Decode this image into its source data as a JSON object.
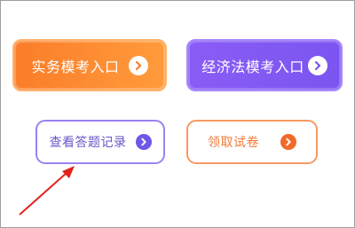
{
  "buttons": {
    "practice_exam": {
      "label": "实务模考入口",
      "icon": "chevron-right-icon"
    },
    "law_exam": {
      "label": "经济法模考入口",
      "icon": "chevron-right-icon"
    },
    "view_records": {
      "label": "查看答题记录",
      "icon": "chevron-right-icon"
    },
    "get_papers": {
      "label": "领取试卷",
      "icon": "chevron-right-icon"
    }
  },
  "annotation": {
    "icon": "red-arrow-icon",
    "color": "#e0231b"
  },
  "colors": {
    "orange": "#fb7d2a",
    "purple": "#8a5cf6",
    "outline_purple": "#9b82f0",
    "outline_orange": "#f79a62"
  }
}
